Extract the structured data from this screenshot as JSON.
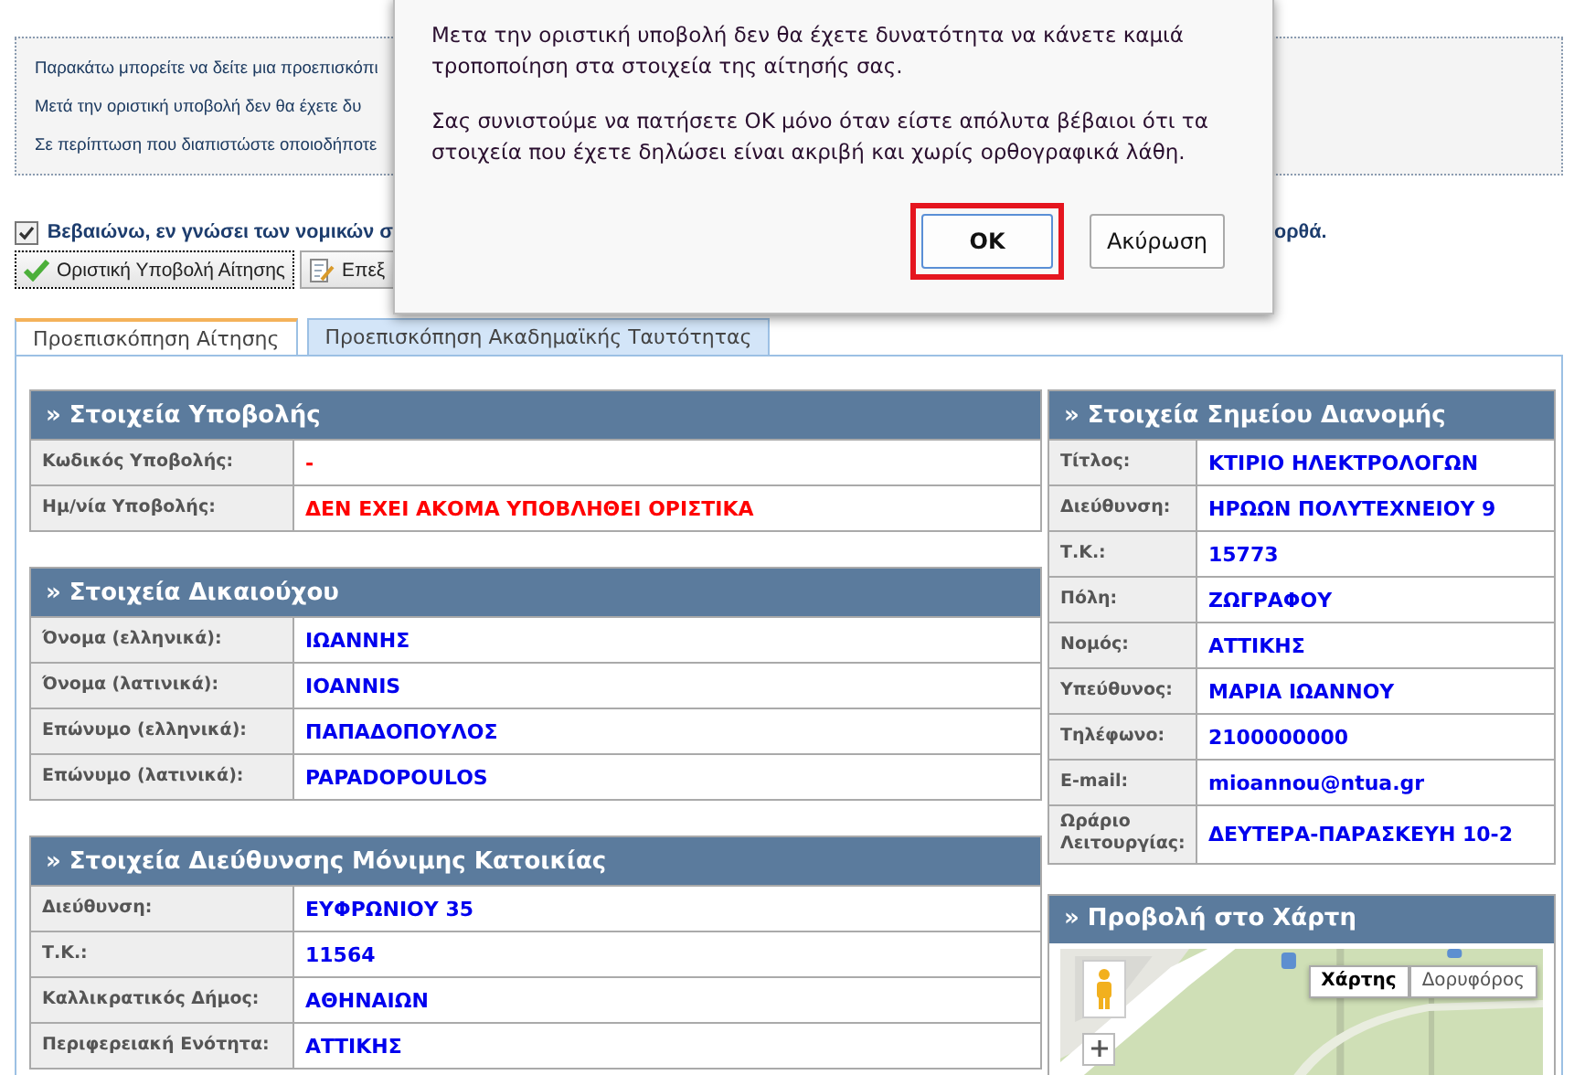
{
  "notice": {
    "lines": [
      "Παρακάτω μπορείτε να δείτε μια προεπισκόπι",
      "Μετά την οριστική υποβολή δεν θα έχετε δυ",
      "Σε περίπτωση που διαπιστώστε οποιοδήποτε"
    ]
  },
  "confirm": {
    "checked": true,
    "text": "Βεβαιώνω, εν γνώσει των νομικών σ",
    "text_end": "ορθά."
  },
  "actions": [
    {
      "label": "Οριστική Υποβολή Αίτησης",
      "kind": "submit"
    },
    {
      "label": "Επεξ",
      "kind": "edit"
    }
  ],
  "tabs": [
    {
      "label": "Προεπισκόπηση Αίτησης",
      "selected": true
    },
    {
      "label": "Προεπισκόπηση Ακαδημαϊκής Ταυτότητας",
      "selected": false
    }
  ],
  "left_sections": [
    {
      "title": "» Στοιχεία Υποβολής",
      "rows": [
        {
          "label": "Κωδικός Υποβολής:",
          "value": "-",
          "alert": true
        },
        {
          "label": "Ημ/νία Υποβολής:",
          "value": "ΔΕΝ ΕΧΕΙ ΑΚΟΜΑ ΥΠΟΒΛΗΘΕΙ ΟΡΙΣΤΙΚΑ",
          "alert": true
        }
      ]
    },
    {
      "title": "» Στοιχεία Δικαιούχου",
      "rows": [
        {
          "label": "Όνομα (ελληνικά):",
          "value": "ΙΩΑΝΝΗΣ",
          "alert": false
        },
        {
          "label": "Όνομα (λατινικά):",
          "value": "IOANNIS",
          "alert": false
        },
        {
          "label": "Επώνυμο (ελληνικά):",
          "value": "ΠΑΠΑΔΟΠΟΥΛΟΣ",
          "alert": false
        },
        {
          "label": "Επώνυμο (λατινικά):",
          "value": "PAPADOPOULOS",
          "alert": false
        }
      ]
    },
    {
      "title": "» Στοιχεία Διεύθυνσης Μόνιμης Κατοικίας",
      "rows": [
        {
          "label": "Διεύθυνση:",
          "value": "ΕΥΦΡΩΝΙΟΥ 35",
          "alert": false
        },
        {
          "label": "Τ.Κ.:",
          "value": "11564",
          "alert": false
        },
        {
          "label": "Καλλικρατικός Δήμος:",
          "value": "ΑΘΗΝΑΙΩΝ",
          "alert": false
        },
        {
          "label": "Περιφερειακή Ενότητα:",
          "value": "ΑΤΤΙΚΗΣ",
          "alert": false
        }
      ]
    }
  ],
  "right_section": {
    "title": "» Στοιχεία Σημείου Διανομής",
    "rows": [
      {
        "label": "Τίτλος:",
        "value": "ΚΤΙΡΙΟ ΗΛΕΚΤΡΟΛΟΓΩΝ",
        "alert": false
      },
      {
        "label": "Διεύθυνση:",
        "value": "ΗΡΩΩΝ ΠΟΛΥΤΕΧΝΕΙΟΥ 9",
        "alert": false
      },
      {
        "label": "Τ.Κ.:",
        "value": "15773",
        "alert": false
      },
      {
        "label": "Πόλη:",
        "value": "ΖΩΓΡΑΦΟΥ",
        "alert": false
      },
      {
        "label": "Νομός:",
        "value": "ΑΤΤΙΚΗΣ",
        "alert": false
      },
      {
        "label": "Υπεύθυνος:",
        "value": "ΜΑΡΙΑ ΙΩΑΝΝΟΥ",
        "alert": false
      },
      {
        "label": "Τηλέφωνο:",
        "value": "2100000000",
        "alert": false
      },
      {
        "label": "E-mail:",
        "value": "mioannou@ntua.gr",
        "alert": false
      },
      {
        "label": "Ωράριο Λειτουργίας:",
        "value": "ΔΕΥΤΕΡΑ-ΠΑΡΑΣΚΕΥΗ 10-2",
        "alert": false
      }
    ]
  },
  "map_section": {
    "title": "» Προβολή στο Χάρτη",
    "map_types": [
      {
        "label": "Χάρτης",
        "selected": true
      },
      {
        "label": "Δορυφόρος",
        "selected": false
      }
    ]
  },
  "dialog": {
    "paragraphs": [
      "Μετα την οριστική υποβολή δεν θα έχετε δυνατότητα να κάνετε καμιά τροποποίηση στα στοιχεία της αίτησής σας.",
      "Σας συνιστούμε να πατήσετε ΟΚ μόνο όταν είστε απόλυτα βέβαιοι ότι τα στοιχεία που έχετε δηλώσει είναι ακριβή και χωρίς ορθογραφικά λάθη."
    ],
    "buttons": [
      {
        "label": "OK",
        "highlighted": true
      },
      {
        "label": "Ακύρωση",
        "highlighted": false
      }
    ]
  }
}
